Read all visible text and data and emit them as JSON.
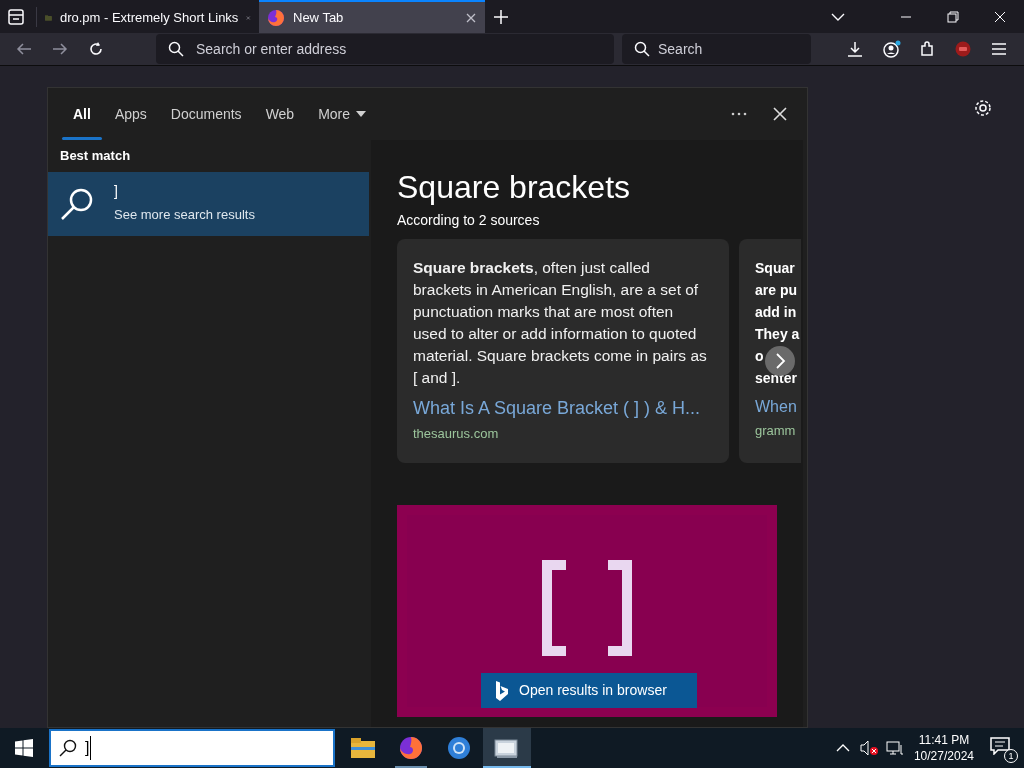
{
  "browser": {
    "tabs": [
      {
        "title": "dro.pm - Extremely Short Links",
        "kind": "folder",
        "selected": false
      },
      {
        "title": "New Tab",
        "kind": "firefox",
        "selected": true
      }
    ],
    "address_placeholder": "Search or enter address",
    "search_placeholder": "Search"
  },
  "search_panel": {
    "tabs": [
      {
        "label": "All",
        "selected": true,
        "has_menu": false
      },
      {
        "label": "Apps",
        "selected": false,
        "has_menu": false
      },
      {
        "label": "Documents",
        "selected": false,
        "has_menu": false
      },
      {
        "label": "Web",
        "selected": false,
        "has_menu": false
      },
      {
        "label": "More",
        "selected": false,
        "has_menu": true
      }
    ],
    "section_label": "Best match",
    "best_match": {
      "title": "]",
      "subtitle": "See more search results",
      "selected": true
    },
    "answer": {
      "title": "Square brackets",
      "subtitle": "According to 2 sources",
      "cards": [
        {
          "text": "**Square brackets**, often just called brackets in American English, are a set of punctuation marks that are most often used to alter or add information to quoted material. Square brackets come in pairs as [ and ].",
          "link": "What Is A Square Bracket ( ] ) & H...",
          "source": "thesaurus.com"
        },
        {
          "lines": [
            "Squar",
            "are pu",
            "add in",
            "They a",
            "o",
            "senter"
          ],
          "link": "When",
          "source": "gramm"
        }
      ]
    },
    "open_button": "Open results in browser"
  },
  "taskbar": {
    "search_value": "]",
    "apps": [
      {
        "kind": "folder",
        "running": false,
        "active": false
      },
      {
        "kind": "firefox",
        "running": true,
        "active": false
      },
      {
        "kind": "chrome",
        "running": false,
        "active": false
      },
      {
        "kind": "window",
        "running": true,
        "active": true
      }
    ],
    "time": "11:41 PM",
    "date": "10/27/2024",
    "notifications": "1"
  }
}
